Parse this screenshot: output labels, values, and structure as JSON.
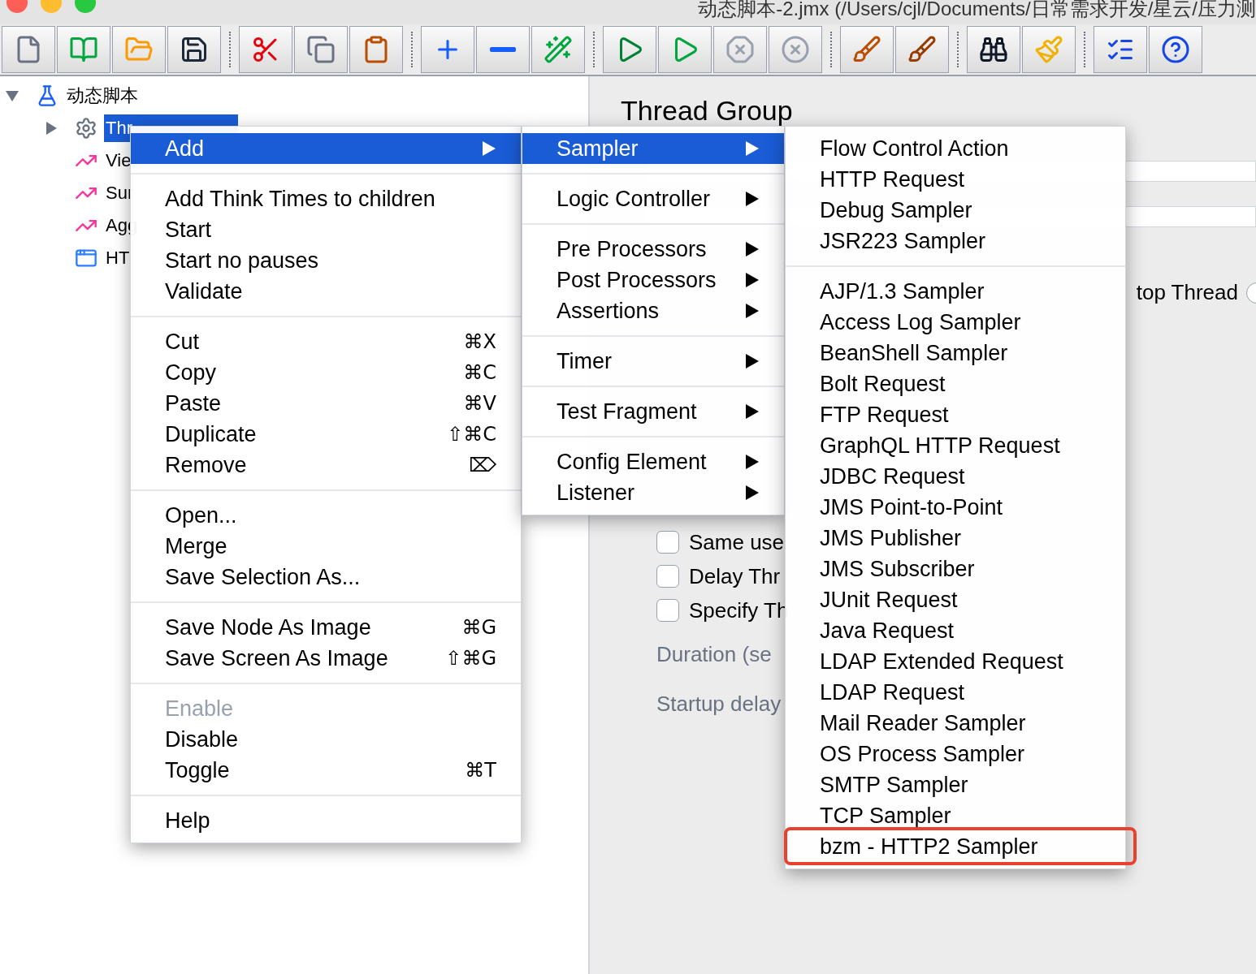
{
  "window": {
    "title": "动态脚本-2.jmx (/Users/cjl/Documents/日常需求开发/星云/压力测"
  },
  "toolbar": {
    "groups": [
      [
        {
          "kind": "new"
        },
        {
          "kind": "templates"
        },
        {
          "kind": "open"
        },
        {
          "kind": "save"
        }
      ],
      [
        {
          "kind": "cut"
        },
        {
          "kind": "copy"
        },
        {
          "kind": "paste"
        }
      ],
      [
        {
          "kind": "expand"
        },
        {
          "kind": "collapse"
        },
        {
          "kind": "toggle"
        }
      ],
      [
        {
          "kind": "start"
        },
        {
          "kind": "start_no_pauses"
        },
        {
          "kind": "stop"
        },
        {
          "kind": "shutdown"
        }
      ],
      [
        {
          "kind": "clear"
        },
        {
          "kind": "clear_all"
        }
      ],
      [
        {
          "kind": "search"
        },
        {
          "kind": "reset_search"
        }
      ],
      [
        {
          "kind": "functions"
        },
        {
          "kind": "help"
        }
      ]
    ]
  },
  "tree": {
    "items": [
      {
        "label": "动态脚本",
        "kind": "plan",
        "expanded": true,
        "selected": false,
        "children": [
          {
            "label": "Thr",
            "kind": "thread_group",
            "expanded": false,
            "selected": true
          },
          {
            "label": "Vie",
            "kind": "listener",
            "selected": false
          },
          {
            "label": "Sur",
            "kind": "listener",
            "selected": false
          },
          {
            "label": "Agg",
            "kind": "listener",
            "selected": false
          },
          {
            "label": "HT",
            "kind": "recorder",
            "selected": false
          }
        ]
      }
    ]
  },
  "panel": {
    "title": "Thread Group",
    "stop_thread": {
      "label": "top Thread",
      "selected": false
    },
    "checkboxes": [
      {
        "label": "Same use",
        "checked": false
      },
      {
        "label": "Delay Thr",
        "checked": false
      },
      {
        "label": "Specify Th",
        "checked": false
      }
    ],
    "duration": "Duration (se",
    "startup_delay": "Startup delay"
  },
  "context_menu": {
    "groups": [
      [
        {
          "label": "Add",
          "submenu": true,
          "selected": true,
          "disabled": false
        }
      ],
      [
        {
          "label": "Add Think Times to children",
          "submenu": false,
          "selected": false,
          "disabled": false
        },
        {
          "label": "Start",
          "submenu": false,
          "selected": false,
          "disabled": false
        },
        {
          "label": "Start no pauses",
          "submenu": false,
          "selected": false,
          "disabled": false
        },
        {
          "label": "Validate",
          "submenu": false,
          "selected": false,
          "disabled": false
        }
      ],
      [
        {
          "label": "Cut",
          "shortcut": "⌘X",
          "submenu": false,
          "selected": false,
          "disabled": false
        },
        {
          "label": "Copy",
          "shortcut": "⌘C",
          "submenu": false,
          "selected": false,
          "disabled": false
        },
        {
          "label": "Paste",
          "shortcut": "⌘V",
          "submenu": false,
          "selected": false,
          "disabled": false
        },
        {
          "label": "Duplicate",
          "shortcut": "⇧⌘C",
          "submenu": false,
          "selected": false,
          "disabled": false
        },
        {
          "label": "Remove",
          "shortcut": "⌦",
          "submenu": false,
          "selected": false,
          "disabled": false
        }
      ],
      [
        {
          "label": "Open...",
          "submenu": false,
          "selected": false,
          "disabled": false
        },
        {
          "label": "Merge",
          "submenu": false,
          "selected": false,
          "disabled": false
        },
        {
          "label": "Save Selection As...",
          "submenu": false,
          "selected": false,
          "disabled": false
        }
      ],
      [
        {
          "label": "Save Node As Image",
          "shortcut": "⌘G",
          "submenu": false,
          "selected": false,
          "disabled": false
        },
        {
          "label": "Save Screen As Image",
          "shortcut": "⇧⌘G",
          "submenu": false,
          "selected": false,
          "disabled": false
        }
      ],
      [
        {
          "label": "Enable",
          "submenu": false,
          "selected": false,
          "disabled": true
        },
        {
          "label": "Disable",
          "submenu": false,
          "selected": false,
          "disabled": false
        },
        {
          "label": "Toggle",
          "shortcut": "⌘T",
          "submenu": false,
          "selected": false,
          "disabled": false
        }
      ],
      [
        {
          "label": "Help",
          "submenu": false,
          "selected": false,
          "disabled": false
        }
      ]
    ]
  },
  "add_submenu": {
    "groups": [
      [
        {
          "label": "Sampler",
          "submenu": true,
          "selected": true
        }
      ],
      [
        {
          "label": "Logic Controller",
          "submenu": true,
          "selected": false
        }
      ],
      [
        {
          "label": "Pre Processors",
          "submenu": true,
          "selected": false
        },
        {
          "label": "Post Processors",
          "submenu": true,
          "selected": false
        },
        {
          "label": "Assertions",
          "submenu": true,
          "selected": false
        }
      ],
      [
        {
          "label": "Timer",
          "submenu": true,
          "selected": false
        }
      ],
      [
        {
          "label": "Test Fragment",
          "submenu": true,
          "selected": false
        }
      ],
      [
        {
          "label": "Config Element",
          "submenu": true,
          "selected": false
        },
        {
          "label": "Listener",
          "submenu": true,
          "selected": false
        }
      ]
    ]
  },
  "sampler_submenu": {
    "groups": [
      [
        {
          "label": "Flow Control Action",
          "selected": false,
          "highlighted": false
        },
        {
          "label": "HTTP Request",
          "selected": false,
          "highlighted": false
        },
        {
          "label": "Debug Sampler",
          "selected": false,
          "highlighted": false
        },
        {
          "label": "JSR223 Sampler",
          "selected": false,
          "highlighted": false
        }
      ],
      [
        {
          "label": "AJP/1.3 Sampler",
          "selected": false,
          "highlighted": false
        },
        {
          "label": "Access Log Sampler",
          "selected": false,
          "highlighted": false
        },
        {
          "label": "BeanShell Sampler",
          "selected": false,
          "highlighted": false
        },
        {
          "label": "Bolt Request",
          "selected": false,
          "highlighted": false
        },
        {
          "label": "FTP Request",
          "selected": false,
          "highlighted": false
        },
        {
          "label": "GraphQL HTTP Request",
          "selected": false,
          "highlighted": false
        },
        {
          "label": "JDBC Request",
          "selected": false,
          "highlighted": false
        },
        {
          "label": "JMS Point-to-Point",
          "selected": false,
          "highlighted": false
        },
        {
          "label": "JMS Publisher",
          "selected": false,
          "highlighted": false
        },
        {
          "label": "JMS Subscriber",
          "selected": false,
          "highlighted": false
        },
        {
          "label": "JUnit Request",
          "selected": false,
          "highlighted": false
        },
        {
          "label": "Java Request",
          "selected": false,
          "highlighted": false
        },
        {
          "label": "LDAP Extended Request",
          "selected": false,
          "highlighted": false
        },
        {
          "label": "LDAP Request",
          "selected": false,
          "highlighted": false
        },
        {
          "label": "Mail Reader Sampler",
          "selected": false,
          "highlighted": false
        },
        {
          "label": "OS Process Sampler",
          "selected": false,
          "highlighted": false
        },
        {
          "label": "SMTP Sampler",
          "selected": false,
          "highlighted": false
        },
        {
          "label": "TCP Sampler",
          "selected": false,
          "highlighted": false
        },
        {
          "label": "bzm - HTTP2 Sampler",
          "selected": false,
          "highlighted": true
        }
      ]
    ]
  }
}
